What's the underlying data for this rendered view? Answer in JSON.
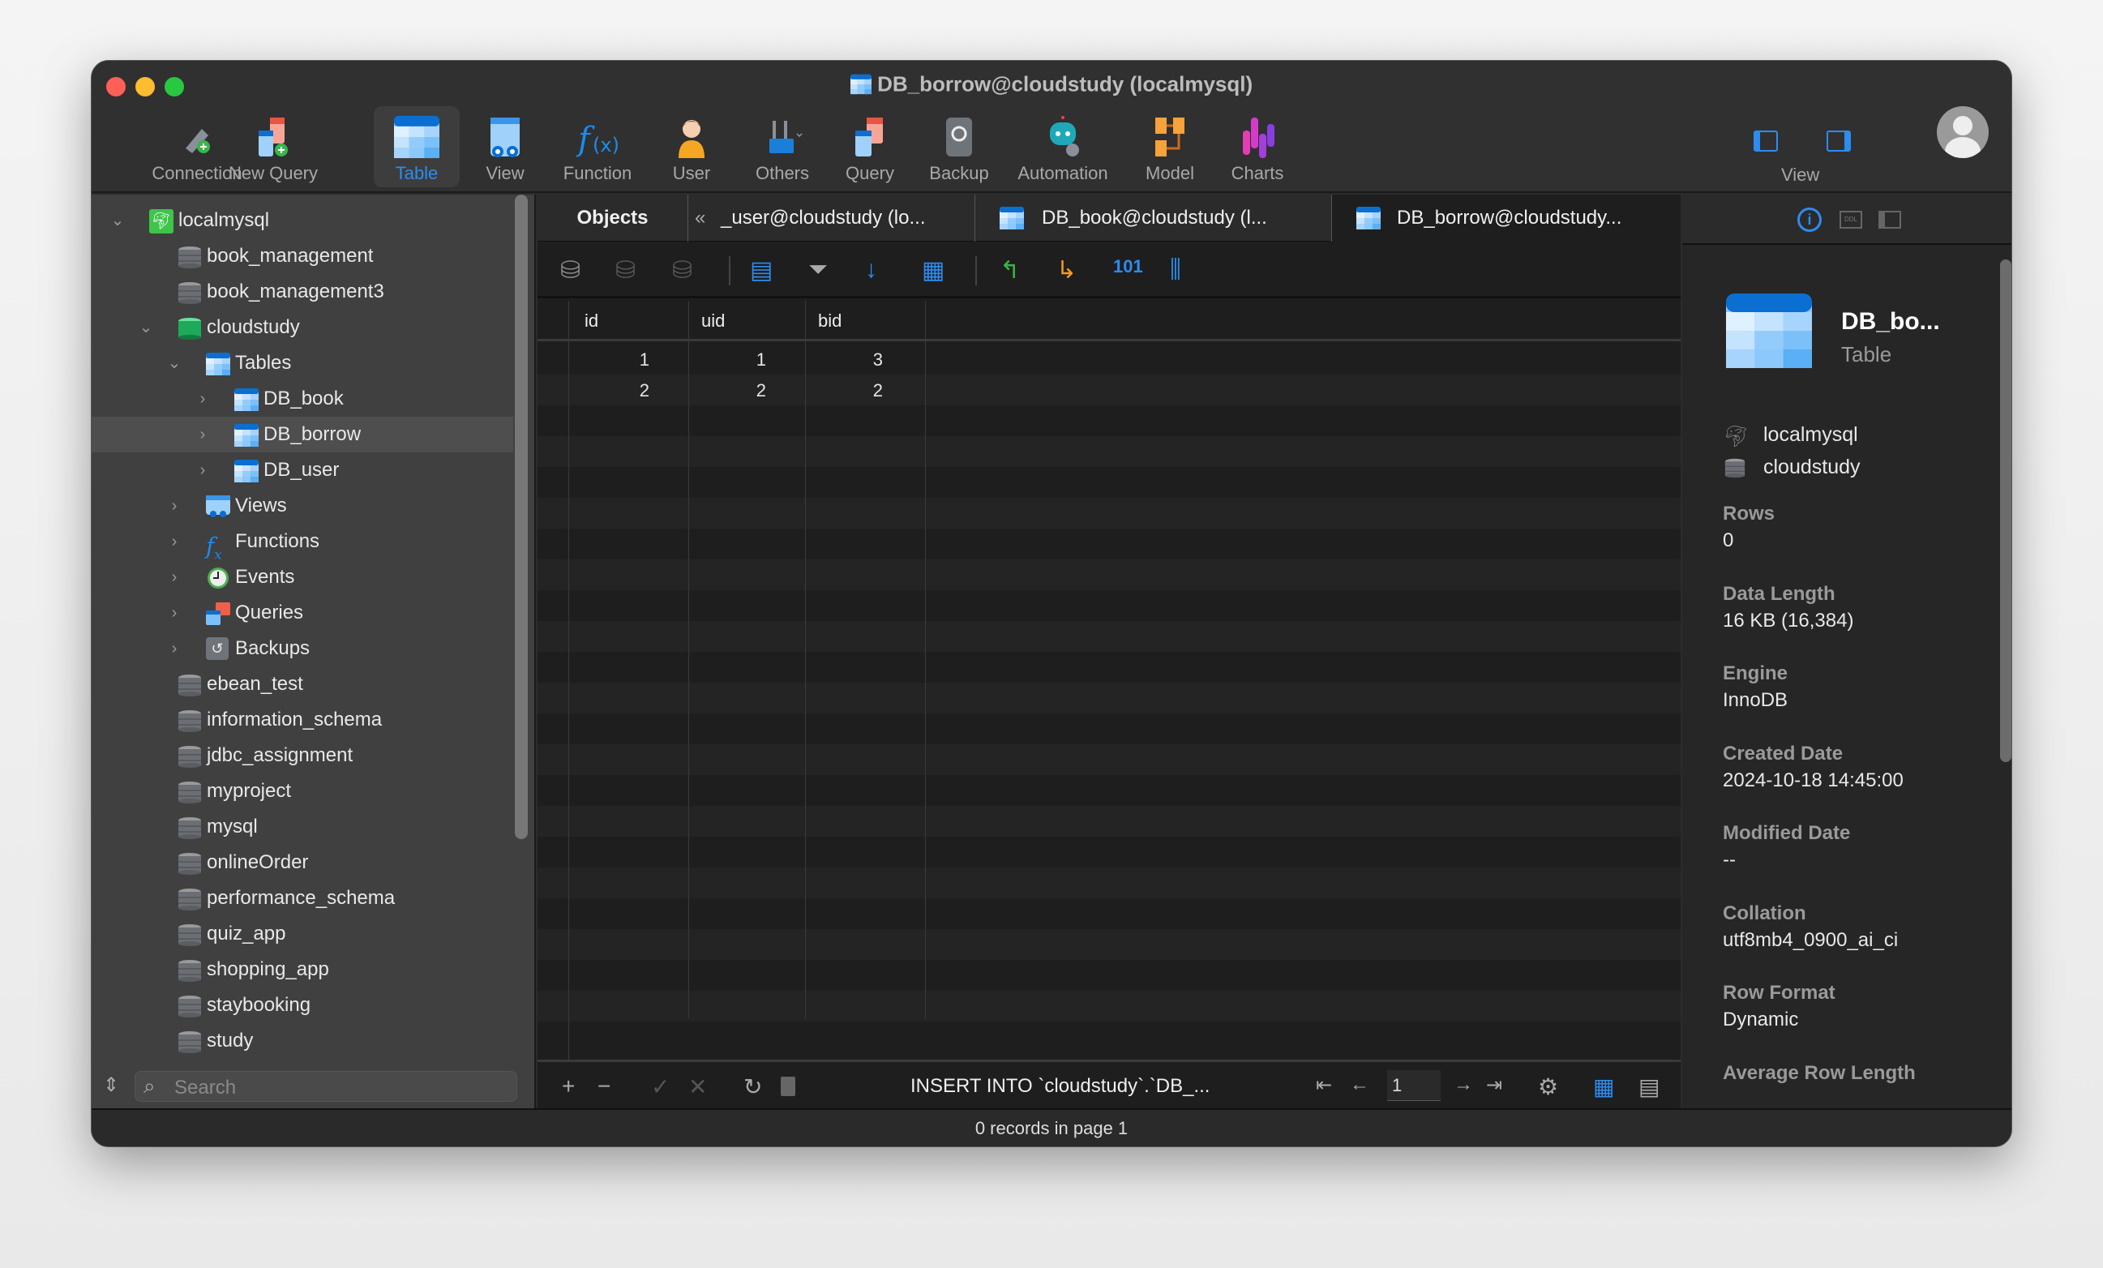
{
  "window": {
    "title": "DB_borrow@cloudstudy (localmysql)"
  },
  "toolbar": {
    "items": [
      {
        "label": "Connection",
        "icon": "plug-icon"
      },
      {
        "label": "New Query",
        "icon": "new-query-icon"
      },
      {
        "label": "Table",
        "icon": "table-icon",
        "active": true
      },
      {
        "label": "View",
        "icon": "view-icon"
      },
      {
        "label": "Function",
        "icon": "function-icon"
      },
      {
        "label": "User",
        "icon": "user-icon"
      },
      {
        "label": "Others",
        "icon": "tools-icon"
      },
      {
        "label": "Query",
        "icon": "query-icon"
      },
      {
        "label": "Backup",
        "icon": "backup-icon"
      },
      {
        "label": "Automation",
        "icon": "robot-icon"
      },
      {
        "label": "Model",
        "icon": "model-icon"
      },
      {
        "label": "Charts",
        "icon": "charts-icon"
      }
    ],
    "view_label": "View",
    "accent": "#2d8cf0"
  },
  "sidebar": {
    "connection": "localmysql",
    "databases_before": [
      "book_management",
      "book_management3"
    ],
    "open_db": "cloudstudy",
    "tables_label": "Tables",
    "tables": [
      "DB_book",
      "DB_borrow",
      "DB_user"
    ],
    "selected_table": "DB_borrow",
    "groups": [
      "Views",
      "Functions",
      "Events",
      "Queries",
      "Backups"
    ],
    "databases_after": [
      "ebean_test",
      "information_schema",
      "jdbc_assignment",
      "myproject",
      "mysql",
      "onlineOrder",
      "performance_schema",
      "quiz_app",
      "shopping_app",
      "staybooking",
      "study"
    ],
    "search_placeholder": "Search"
  },
  "tabs": {
    "objects": "Objects",
    "items": [
      "_user@cloudstudy (lo...",
      "DB_book@cloudstudy (l...",
      "DB_borrow@cloudstudy..."
    ],
    "active_index": 2
  },
  "grid": {
    "columns": [
      "id",
      "uid",
      "bid"
    ],
    "rows": [
      [
        "1",
        "1",
        "3"
      ],
      [
        "2",
        "2",
        "2"
      ]
    ]
  },
  "bottom": {
    "sql": "INSERT INTO `cloudstudy`.`DB_...",
    "page": "1",
    "status": "0 records in page 1"
  },
  "info": {
    "name": "DB_bo...",
    "type": "Table",
    "connection": "localmysql",
    "database": "cloudstudy",
    "fields": [
      {
        "label": "Rows",
        "value": "0"
      },
      {
        "label": "Data Length",
        "value": "16 KB (16,384)"
      },
      {
        "label": "Engine",
        "value": "InnoDB"
      },
      {
        "label": "Created Date",
        "value": "2024-10-18 14:45:00"
      },
      {
        "label": "Modified Date",
        "value": "--"
      },
      {
        "label": "Collation",
        "value": "utf8mb4_0900_ai_ci"
      },
      {
        "label": "Row Format",
        "value": "Dynamic"
      },
      {
        "label": "Average Row Length",
        "value": ""
      }
    ]
  }
}
